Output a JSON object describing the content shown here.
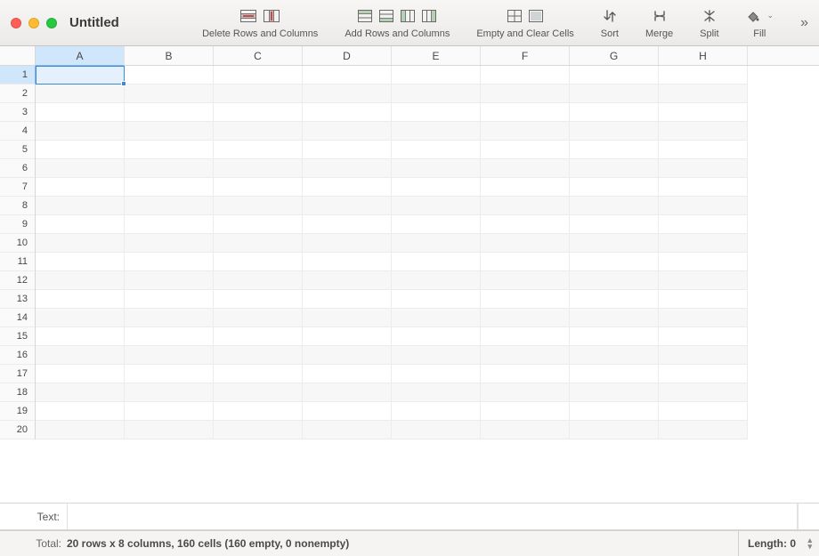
{
  "window": {
    "title": "Untitled"
  },
  "toolbar": {
    "delete": {
      "label": "Delete Rows and Columns"
    },
    "add": {
      "label": "Add Rows and Columns"
    },
    "empty": {
      "label": "Empty and Clear Cells"
    },
    "sort": {
      "label": "Sort"
    },
    "merge": {
      "label": "Merge"
    },
    "split": {
      "label": "Split"
    },
    "fill": {
      "label": "Fill"
    }
  },
  "sheet": {
    "columns": [
      "A",
      "B",
      "C",
      "D",
      "E",
      "F",
      "G",
      "H"
    ],
    "rows": [
      "1",
      "2",
      "3",
      "4",
      "5",
      "6",
      "7",
      "8",
      "9",
      "10",
      "11",
      "12",
      "13",
      "14",
      "15",
      "16",
      "17",
      "18",
      "19",
      "20"
    ],
    "selected_cell": "A1"
  },
  "textbar": {
    "label": "Text:",
    "value": ""
  },
  "status": {
    "total_label": "Total:",
    "total_value": "20 rows x 8 columns, 160 cells (160 empty, 0 nonempty)",
    "length": "Length: 0"
  }
}
